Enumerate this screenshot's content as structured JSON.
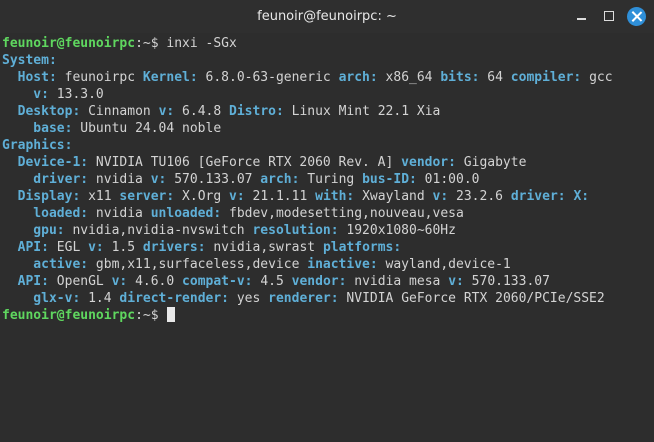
{
  "window": {
    "title": "feunoir@feunoirpc: ~"
  },
  "terminal": {
    "prompt": "feunoir@feunoirpc",
    "prompt_suffix": ":~$",
    "command": "inxi -SGx",
    "lines": [
      [
        {
          "t": "System:",
          "c": "k"
        }
      ],
      [
        {
          "t": "  Host:",
          "c": "k"
        },
        {
          "t": " feunoirpc ",
          "c": "v"
        },
        {
          "t": "Kernel:",
          "c": "k"
        },
        {
          "t": " 6.8.0-63-generic ",
          "c": "v"
        },
        {
          "t": "arch:",
          "c": "k"
        },
        {
          "t": " x86_64 ",
          "c": "v"
        },
        {
          "t": "bits:",
          "c": "k"
        },
        {
          "t": " 64 ",
          "c": "v"
        },
        {
          "t": "compiler:",
          "c": "k"
        },
        {
          "t": " gcc",
          "c": "v"
        }
      ],
      [
        {
          "t": "    v:",
          "c": "k"
        },
        {
          "t": " 13.3.0",
          "c": "v"
        }
      ],
      [
        {
          "t": "  Desktop:",
          "c": "k"
        },
        {
          "t": " Cinnamon ",
          "c": "v"
        },
        {
          "t": "v:",
          "c": "k"
        },
        {
          "t": " 6.4.8 ",
          "c": "v"
        },
        {
          "t": "Distro:",
          "c": "k"
        },
        {
          "t": " Linux Mint 22.1 Xia",
          "c": "v"
        }
      ],
      [
        {
          "t": "    base:",
          "c": "k"
        },
        {
          "t": " Ubuntu 24.04 noble",
          "c": "v"
        }
      ],
      [
        {
          "t": "Graphics:",
          "c": "k"
        }
      ],
      [
        {
          "t": "  Device-1:",
          "c": "k"
        },
        {
          "t": " NVIDIA TU106 [GeForce RTX 2060 Rev. A] ",
          "c": "v"
        },
        {
          "t": "vendor:",
          "c": "k"
        },
        {
          "t": " Gigabyte",
          "c": "v"
        }
      ],
      [
        {
          "t": "    driver:",
          "c": "k"
        },
        {
          "t": " nvidia ",
          "c": "v"
        },
        {
          "t": "v:",
          "c": "k"
        },
        {
          "t": " 570.133.07 ",
          "c": "v"
        },
        {
          "t": "arch:",
          "c": "k"
        },
        {
          "t": " Turing ",
          "c": "v"
        },
        {
          "t": "bus-ID:",
          "c": "k"
        },
        {
          "t": " 01:00.0",
          "c": "v"
        }
      ],
      [
        {
          "t": "  Display:",
          "c": "k"
        },
        {
          "t": " x11 ",
          "c": "v"
        },
        {
          "t": "server:",
          "c": "k"
        },
        {
          "t": " X.Org ",
          "c": "v"
        },
        {
          "t": "v:",
          "c": "k"
        },
        {
          "t": " 21.1.11 ",
          "c": "v"
        },
        {
          "t": "with:",
          "c": "k"
        },
        {
          "t": " Xwayland ",
          "c": "v"
        },
        {
          "t": "v:",
          "c": "k"
        },
        {
          "t": " 23.2.6 ",
          "c": "v"
        },
        {
          "t": "driver:",
          "c": "k"
        },
        {
          "t": " X:",
          "c": "k"
        }
      ],
      [
        {
          "t": "    loaded:",
          "c": "k"
        },
        {
          "t": " nvidia ",
          "c": "v"
        },
        {
          "t": "unloaded:",
          "c": "k"
        },
        {
          "t": " fbdev,modesetting,nouveau,vesa",
          "c": "v"
        }
      ],
      [
        {
          "t": "    gpu:",
          "c": "k"
        },
        {
          "t": " nvidia,nvidia-nvswitch ",
          "c": "v"
        },
        {
          "t": "resolution:",
          "c": "k"
        },
        {
          "t": " 1920x1080~60Hz",
          "c": "v"
        }
      ],
      [
        {
          "t": "  API:",
          "c": "k"
        },
        {
          "t": " EGL ",
          "c": "v"
        },
        {
          "t": "v:",
          "c": "k"
        },
        {
          "t": " 1.5 ",
          "c": "v"
        },
        {
          "t": "drivers:",
          "c": "k"
        },
        {
          "t": " nvidia,swrast ",
          "c": "v"
        },
        {
          "t": "platforms:",
          "c": "k"
        }
      ],
      [
        {
          "t": "    active:",
          "c": "k"
        },
        {
          "t": " gbm,x11,surfaceless,device ",
          "c": "v"
        },
        {
          "t": "inactive:",
          "c": "k"
        },
        {
          "t": " wayland,device-1",
          "c": "v"
        }
      ],
      [
        {
          "t": "  API:",
          "c": "k"
        },
        {
          "t": " OpenGL ",
          "c": "v"
        },
        {
          "t": "v:",
          "c": "k"
        },
        {
          "t": " 4.6.0 ",
          "c": "v"
        },
        {
          "t": "compat-v:",
          "c": "k"
        },
        {
          "t": " 4.5 ",
          "c": "v"
        },
        {
          "t": "vendor:",
          "c": "k"
        },
        {
          "t": " nvidia mesa ",
          "c": "v"
        },
        {
          "t": "v:",
          "c": "k"
        },
        {
          "t": " 570.133.07",
          "c": "v"
        }
      ],
      [
        {
          "t": "    glx-v:",
          "c": "k"
        },
        {
          "t": " 1.4 ",
          "c": "v"
        },
        {
          "t": "direct-render:",
          "c": "k"
        },
        {
          "t": " yes ",
          "c": "v"
        },
        {
          "t": "renderer:",
          "c": "k"
        },
        {
          "t": " NVIDIA GeForce RTX 2060/PCIe/SSE2",
          "c": "v"
        }
      ]
    ]
  },
  "colors": {
    "prompt": "#5fd75f",
    "key": "#5fafd7",
    "value": "#d3d3d3",
    "close_button": "#2f8fd8"
  },
  "icons": {
    "minimize": "minimize-icon",
    "maximize": "maximize-icon",
    "close": "close-icon"
  }
}
